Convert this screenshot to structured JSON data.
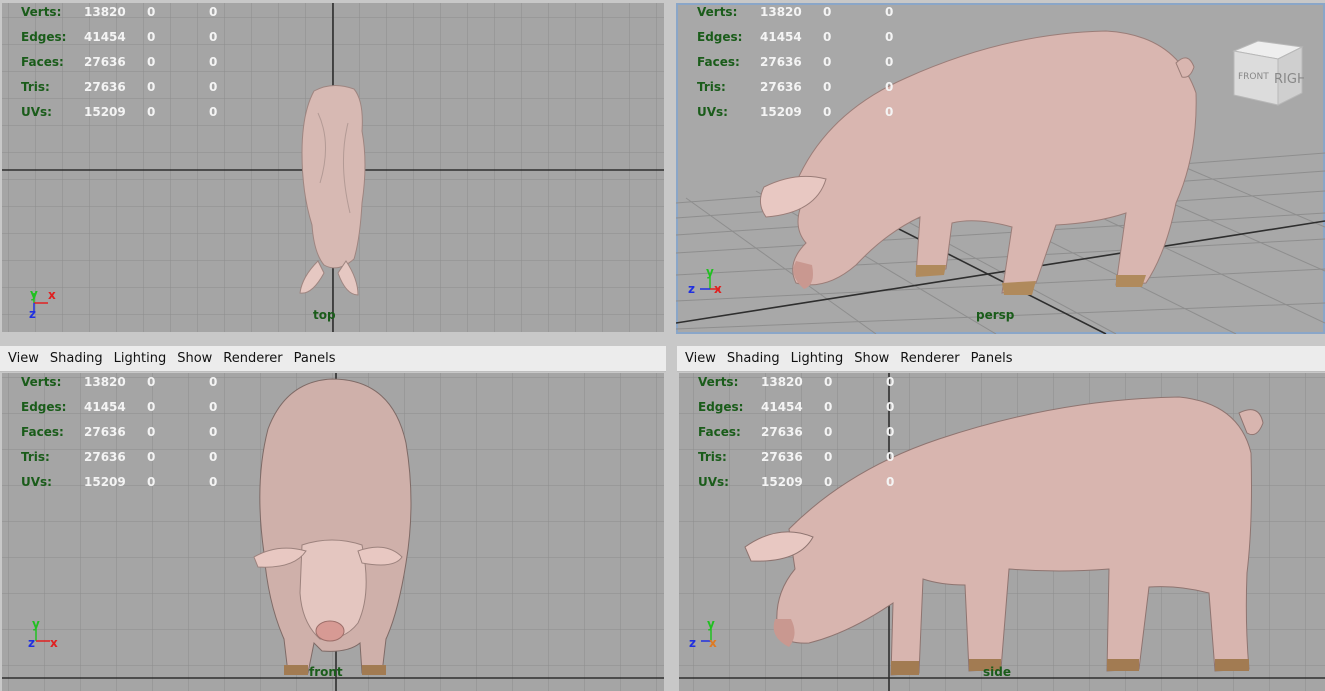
{
  "menu": [
    "View",
    "Shading",
    "Lighting",
    "Show",
    "Renderer",
    "Panels"
  ],
  "hud": [
    {
      "label": "Verts:",
      "values": [
        "13820",
        "0",
        "0"
      ]
    },
    {
      "label": "Edges:",
      "values": [
        "41454",
        "0",
        "0"
      ]
    },
    {
      "label": "Faces:",
      "values": [
        "27636",
        "0",
        "0"
      ]
    },
    {
      "label": "Tris:",
      "values": [
        "27636",
        "0",
        "0"
      ]
    },
    {
      "label": "UVs:",
      "values": [
        "15209",
        "0",
        "0"
      ]
    }
  ],
  "viewports": {
    "top": {
      "camera": "top",
      "axes": [
        "y",
        "x",
        "z"
      ]
    },
    "persp": {
      "camera": "persp",
      "axes": [
        "y",
        "z",
        "x"
      ],
      "viewcube": [
        "RIGHT",
        "FRONT"
      ]
    },
    "front": {
      "camera": "front",
      "axes": [
        "y",
        "z",
        "x"
      ]
    },
    "side": {
      "camera": "side",
      "axes": [
        "y",
        "z",
        "x"
      ]
    }
  },
  "colors": {
    "viewport_bg": "#a5a5a5",
    "hud_label": "#1a5c1a",
    "hud_value": "#f4f4f4",
    "axis_x": "#e02020",
    "axis_y": "#20c020",
    "axis_z": "#2030e0",
    "pig_skin": "#dcbcb6"
  }
}
